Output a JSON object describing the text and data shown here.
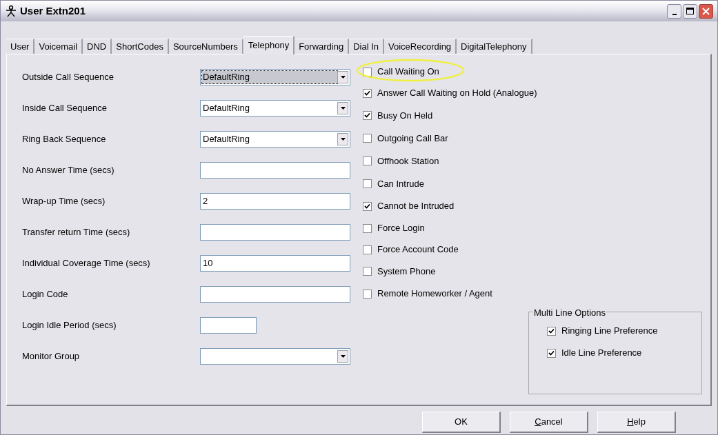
{
  "window": {
    "title": "User Extn201"
  },
  "tabs": [
    {
      "label": "User",
      "selected": false
    },
    {
      "label": "Voicemail",
      "selected": false
    },
    {
      "label": "DND",
      "selected": false
    },
    {
      "label": "ShortCodes",
      "selected": false
    },
    {
      "label": "SourceNumbers",
      "selected": false
    },
    {
      "label": "Telephony",
      "selected": true
    },
    {
      "label": "Forwarding",
      "selected": false
    },
    {
      "label": "Dial In",
      "selected": false
    },
    {
      "label": "VoiceRecording",
      "selected": false
    },
    {
      "label": "DigitalTelephony",
      "selected": false
    }
  ],
  "fields": [
    {
      "label": "Outside Call Sequence",
      "kind": "combo",
      "value": "DefaultRing",
      "focused": true
    },
    {
      "label": "Inside Call Sequence",
      "kind": "combo",
      "value": "DefaultRing",
      "focused": false
    },
    {
      "label": "Ring Back Sequence",
      "kind": "combo",
      "value": "DefaultRing",
      "focused": false
    },
    {
      "label": "No Answer Time (secs)",
      "kind": "text",
      "focused": false
    },
    {
      "label": "Wrap-up Time (secs)",
      "kind": "text",
      "value": "2",
      "focused": false
    },
    {
      "label": "Transfer return Time (secs)",
      "kind": "text",
      "focused": false
    },
    {
      "label": "Individual Coverage Time (secs)",
      "kind": "text",
      "value": "10",
      "focused": false
    },
    {
      "label": "Login Code",
      "kind": "text",
      "focused": false
    },
    {
      "label": "Login Idle Period (secs)",
      "kind": "short",
      "focused": false
    },
    {
      "label": "Monitor Group",
      "kind": "combo",
      "focused": false
    }
  ],
  "options": [
    {
      "label": "Call Waiting On",
      "checked": false,
      "highlighted": true
    },
    {
      "label": "Answer Call Waiting on Hold (Analogue)",
      "checked": true,
      "highlighted": false
    },
    {
      "label": "Busy On Held",
      "checked": true,
      "highlighted": false
    },
    {
      "label": "Outgoing Call Bar",
      "checked": false,
      "highlighted": false
    },
    {
      "label": "Offhook Station",
      "checked": false,
      "highlighted": false
    },
    {
      "label": "Can Intrude",
      "checked": false,
      "highlighted": false
    },
    {
      "label": "Cannot be Intruded",
      "checked": true,
      "highlighted": false
    },
    {
      "label": "Force Login",
      "checked": false,
      "highlighted": false
    },
    {
      "label": "Force Account Code",
      "checked": false,
      "highlighted": false
    },
    {
      "label": "System Phone",
      "checked": false,
      "highlighted": false
    },
    {
      "label": "Remote Homeworker / Agent",
      "checked": false,
      "highlighted": false
    }
  ],
  "multi_line_options": {
    "title": "Multi Line Options",
    "options": [
      {
        "label": "Ringing Line Preference",
        "checked": true
      },
      {
        "label": "Idle Line Preference",
        "checked": true
      }
    ]
  },
  "buttons": [
    {
      "label": "OK",
      "mnemonic": false
    },
    {
      "label": "Cancel",
      "mnemonic": true
    },
    {
      "label": "Help",
      "mnemonic": true
    }
  ]
}
